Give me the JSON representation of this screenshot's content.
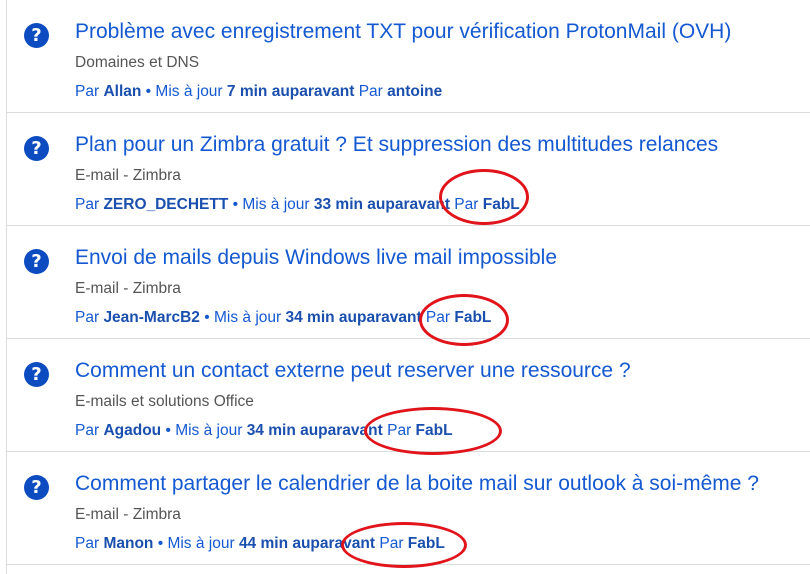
{
  "topics": [
    {
      "icon": "question-circle-icon",
      "title": "Problème avec enregistrement TXT pour vérification ProtonMail (OVH)",
      "category": "Domaines et DNS",
      "by_prefix": "Par",
      "author": "Allan",
      "separator": "•",
      "updated_label": "Mis à jour",
      "updated_age": "7 min auparavant",
      "last_by_prefix": "Par",
      "last_author": "antoine",
      "annotated": false
    },
    {
      "icon": "question-circle-icon",
      "title": "Plan pour un Zimbra gratuit ? Et suppression des multitudes relances",
      "category": "E-mail - Zimbra",
      "by_prefix": "Par",
      "author": "ZERO_DECHETT",
      "separator": "•",
      "updated_label": "Mis à jour",
      "updated_age": "33 min auparavant",
      "last_by_prefix": "Par",
      "last_author": "FabL",
      "annotated": true
    },
    {
      "icon": "question-circle-icon",
      "title": "Envoi de mails depuis Windows live mail impossible",
      "category": "E-mail - Zimbra",
      "by_prefix": "Par",
      "author": "Jean-MarcB2",
      "separator": "•",
      "updated_label": "Mis à jour",
      "updated_age": "34 min auparavant",
      "last_by_prefix": "Par",
      "last_author": "FabL",
      "annotated": true
    },
    {
      "icon": "question-circle-icon",
      "title": "Comment un contact externe peut reserver une ressource ?",
      "category": "E-mails et solutions Office",
      "by_prefix": "Par",
      "author": "Agadou",
      "separator": "•",
      "updated_label": "Mis à jour",
      "updated_age": "34 min auparavant",
      "last_by_prefix": "Par",
      "last_author": "FabL",
      "annotated": true
    },
    {
      "icon": "question-circle-icon",
      "title": "Comment partager le calendrier de la boite mail sur outlook à soi-même ?",
      "category": "E-mail - Zimbra",
      "by_prefix": "Par",
      "author": "Manon",
      "separator": "•",
      "updated_label": "Mis à jour",
      "updated_age": "44 min auparavant",
      "last_by_prefix": "Par",
      "last_author": "FabL",
      "annotated": true
    }
  ],
  "colors": {
    "link": "#1459d1",
    "link_bold": "#1a4fae",
    "category": "#555555",
    "icon_bg": "#0d4cc0",
    "annotation": "#e0141a",
    "divider": "#dcdcdc"
  }
}
